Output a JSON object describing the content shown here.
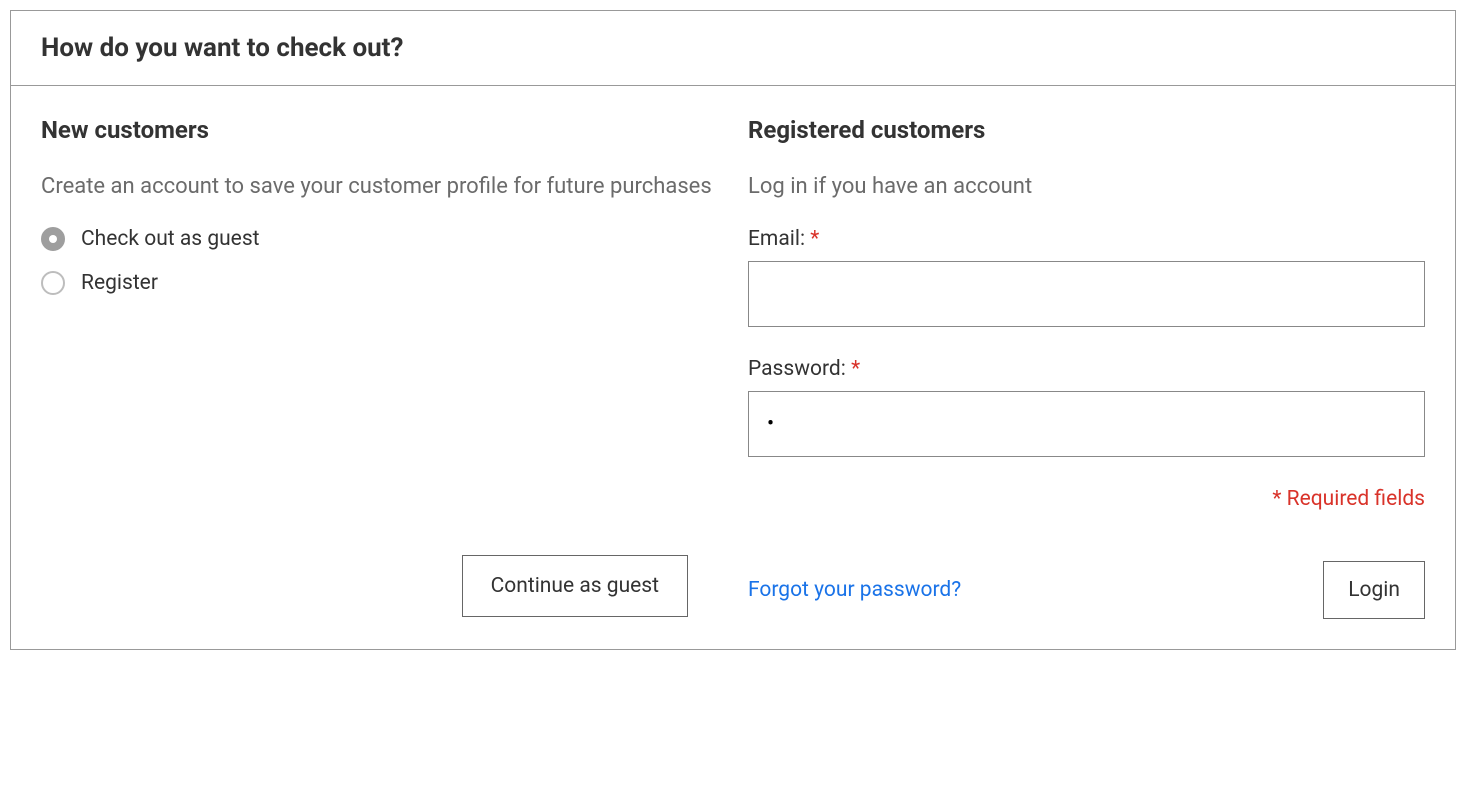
{
  "header": {
    "title": "How do you want to check out?"
  },
  "new_customers": {
    "title": "New customers",
    "subtitle": "Create an account to save your customer profile for future purchases",
    "options": {
      "guest": "Check out as guest",
      "register": "Register"
    },
    "continue_button": "Continue as guest"
  },
  "registered_customers": {
    "title": "Registered customers",
    "subtitle": "Log in if you have an account",
    "email_label": "Email: ",
    "email_value": "",
    "password_label": "Password: ",
    "password_value": " ",
    "required_note": "* Required fields",
    "forgot_link": "Forgot your password?",
    "login_button": "Login",
    "required_star": "*"
  }
}
